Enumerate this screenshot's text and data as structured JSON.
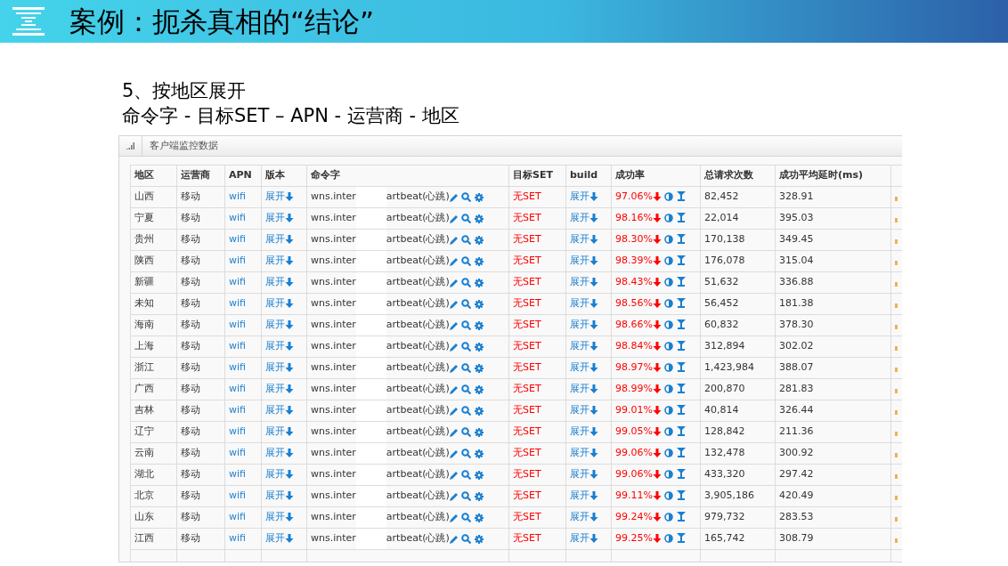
{
  "slide": {
    "title": "案例：扼杀真相的“结论”",
    "subtitle_lines": [
      "5、按地区展开",
      "命令字 - 目标SET – APN - 运营商 - 地区"
    ]
  },
  "panel": {
    "title": "客户端监控数据",
    "table": {
      "columns": [
        "地区",
        "运营商",
        "APN",
        "版本",
        "命令字",
        "目标SET",
        "build",
        "成功率",
        "总请求次数",
        "成功平均延时(ms)"
      ],
      "rows": [
        {
          "region": "山西",
          "carrier": "移动",
          "apn": "wifi",
          "version": "展开",
          "command_start": "wns.inter",
          "command_end": "artbeat(心跳)",
          "target_set": "无SET",
          "build": "展开",
          "success_rate": "97.06%",
          "total_requests": "82,452",
          "avg_latency": "328.91"
        },
        {
          "region": "宁夏",
          "carrier": "移动",
          "apn": "wifi",
          "version": "展开",
          "command_start": "wns.inter",
          "command_end": "artbeat(心跳)",
          "target_set": "无SET",
          "build": "展开",
          "success_rate": "98.16%",
          "total_requests": "22,014",
          "avg_latency": "395.03"
        },
        {
          "region": "贵州",
          "carrier": "移动",
          "apn": "wifi",
          "version": "展开",
          "command_start": "wns.inter",
          "command_end": "artbeat(心跳)",
          "target_set": "无SET",
          "build": "展开",
          "success_rate": "98.30%",
          "total_requests": "170,138",
          "avg_latency": "349.45"
        },
        {
          "region": "陕西",
          "carrier": "移动",
          "apn": "wifi",
          "version": "展开",
          "command_start": "wns.inter",
          "command_end": "artbeat(心跳)",
          "target_set": "无SET",
          "build": "展开",
          "success_rate": "98.39%",
          "total_requests": "176,078",
          "avg_latency": "315.04"
        },
        {
          "region": "新疆",
          "carrier": "移动",
          "apn": "wifi",
          "version": "展开",
          "command_start": "wns.inter",
          "command_end": "artbeat(心跳)",
          "target_set": "无SET",
          "build": "展开",
          "success_rate": "98.43%",
          "total_requests": "51,632",
          "avg_latency": "336.88"
        },
        {
          "region": "未知",
          "carrier": "移动",
          "apn": "wifi",
          "version": "展开",
          "command_start": "wns.inter",
          "command_end": "artbeat(心跳)",
          "target_set": "无SET",
          "build": "展开",
          "success_rate": "98.56%",
          "total_requests": "56,452",
          "avg_latency": "181.38"
        },
        {
          "region": "海南",
          "carrier": "移动",
          "apn": "wifi",
          "version": "展开",
          "command_start": "wns.inter",
          "command_end": "artbeat(心跳)",
          "target_set": "无SET",
          "build": "展开",
          "success_rate": "98.66%",
          "total_requests": "60,832",
          "avg_latency": "378.30"
        },
        {
          "region": "上海",
          "carrier": "移动",
          "apn": "wifi",
          "version": "展开",
          "command_start": "wns.inter",
          "command_end": "artbeat(心跳)",
          "target_set": "无SET",
          "build": "展开",
          "success_rate": "98.84%",
          "total_requests": "312,894",
          "avg_latency": "302.02"
        },
        {
          "region": "浙江",
          "carrier": "移动",
          "apn": "wifi",
          "version": "展开",
          "command_start": "wns.inter",
          "command_end": "artbeat(心跳)",
          "target_set": "无SET",
          "build": "展开",
          "success_rate": "98.97%",
          "total_requests": "1,423,984",
          "avg_latency": "388.07"
        },
        {
          "region": "广西",
          "carrier": "移动",
          "apn": "wifi",
          "version": "展开",
          "command_start": "wns.inter",
          "command_end": "artbeat(心跳)",
          "target_set": "无SET",
          "build": "展开",
          "success_rate": "98.99%",
          "total_requests": "200,870",
          "avg_latency": "281.83"
        },
        {
          "region": "吉林",
          "carrier": "移动",
          "apn": "wifi",
          "version": "展开",
          "command_start": "wns.inter",
          "command_end": "artbeat(心跳)",
          "target_set": "无SET",
          "build": "展开",
          "success_rate": "99.01%",
          "total_requests": "40,814",
          "avg_latency": "326.44"
        },
        {
          "region": "辽宁",
          "carrier": "移动",
          "apn": "wifi",
          "version": "展开",
          "command_start": "wns.inter",
          "command_end": "artbeat(心跳)",
          "target_set": "无SET",
          "build": "展开",
          "success_rate": "99.05%",
          "total_requests": "128,842",
          "avg_latency": "211.36"
        },
        {
          "region": "云南",
          "carrier": "移动",
          "apn": "wifi",
          "version": "展开",
          "command_start": "wns.inter",
          "command_end": "artbeat(心跳)",
          "target_set": "无SET",
          "build": "展开",
          "success_rate": "99.06%",
          "total_requests": "132,478",
          "avg_latency": "300.92"
        },
        {
          "region": "湖北",
          "carrier": "移动",
          "apn": "wifi",
          "version": "展开",
          "command_start": "wns.inter",
          "command_end": "artbeat(心跳)",
          "target_set": "无SET",
          "build": "展开",
          "success_rate": "99.06%",
          "total_requests": "433,320",
          "avg_latency": "297.42"
        },
        {
          "region": "北京",
          "carrier": "移动",
          "apn": "wifi",
          "version": "展开",
          "command_start": "wns.inter",
          "command_end": "artbeat(心跳)",
          "target_set": "无SET",
          "build": "展开",
          "success_rate": "99.11%",
          "total_requests": "3,905,186",
          "avg_latency": "420.49"
        },
        {
          "region": "山东",
          "carrier": "移动",
          "apn": "wifi",
          "version": "展开",
          "command_start": "wns.inter",
          "command_end": "artbeat(心跳)",
          "target_set": "无SET",
          "build": "展开",
          "success_rate": "99.24%",
          "total_requests": "979,732",
          "avg_latency": "283.53"
        },
        {
          "region": "江西",
          "carrier": "移动",
          "apn": "wifi",
          "version": "展开",
          "command_start": "wns.inter",
          "command_end": "artbeat(心跳)",
          "target_set": "无SET",
          "build": "展开",
          "success_rate": "99.25%",
          "total_requests": "165,742",
          "avg_latency": "308.79"
        }
      ]
    }
  }
}
